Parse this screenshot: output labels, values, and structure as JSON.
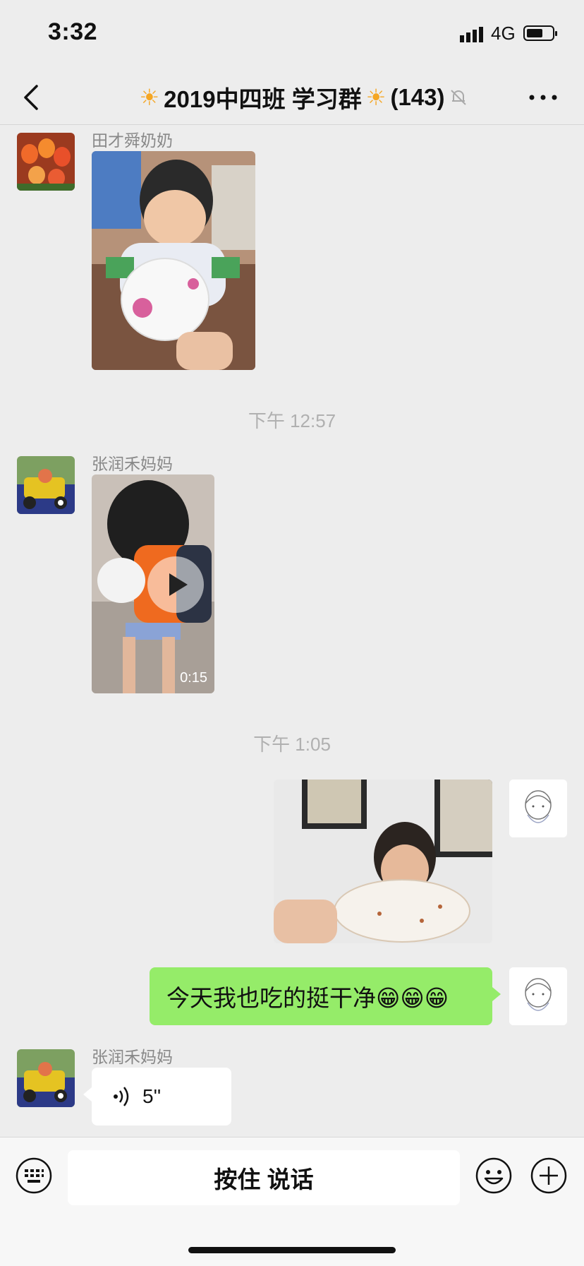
{
  "status_bar": {
    "time": "3:32",
    "network": "4G"
  },
  "nav": {
    "title": "2019中四班 学习群",
    "member_count": "(143)"
  },
  "messages": [
    {
      "sender": "田才舜奶奶",
      "type": "image"
    },
    {
      "timestamp": "下午 12:57"
    },
    {
      "sender": "张润禾妈妈",
      "type": "video",
      "duration": "0:15"
    },
    {
      "timestamp": "下午 1:05"
    },
    {
      "sender": "me",
      "type": "image"
    },
    {
      "sender": "me",
      "type": "text",
      "text": "今天我也吃的挺干净😁😁😁"
    },
    {
      "sender": "张润禾妈妈",
      "type": "voice",
      "duration": "5''"
    }
  ],
  "input_bar": {
    "hold_to_talk": "按住 说话"
  },
  "colors": {
    "background": "#ededed",
    "my_bubble": "#95ec69",
    "other_bubble": "#ffffff"
  }
}
